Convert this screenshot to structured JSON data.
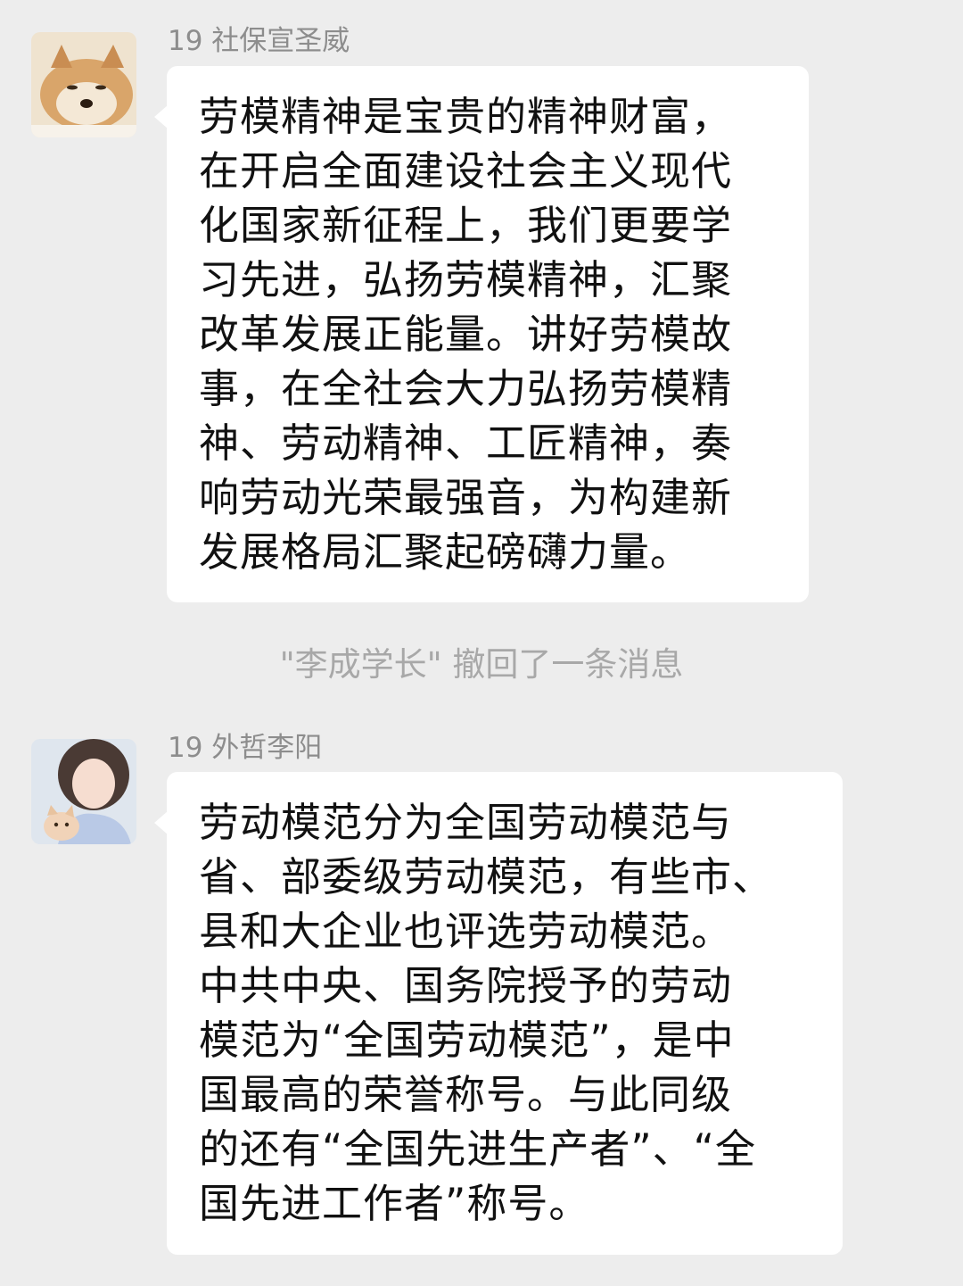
{
  "messages": [
    {
      "sender": "19 社保宣圣威",
      "avatar": "shiba-dog-avatar",
      "lines": [
        "劳模精神是宝贵的精神财富，",
        "在开启全面建设社会主义现代",
        "化国家新征程上，我们更要学",
        "习先进，弘扬劳模精神，汇聚",
        "改革发展正能量。讲好劳模故",
        "事，在全社会大力弘扬劳模精",
        "神、劳动精神、工匠精神，奏",
        "响劳动光荣最强音，为构建新",
        "发展格局汇聚起磅礴力量。"
      ]
    },
    {
      "sender": "19 外哲李阳",
      "avatar": "girl-with-cat-avatar",
      "lines": [
        "劳动模范分为全国劳动模范与",
        "省、部委级劳动模范，有些市、",
        "县和大企业也评选劳动模范。",
        "中共中央、国务院授予的劳动",
        "模范为“全国劳动模范”，是中",
        "国最高的荣誉称号。与此同级",
        "的还有“全国先进生产者”、“全",
        "国先进工作者”称号。"
      ]
    }
  ],
  "system_notice": "\"李成学长\" 撤回了一条消息",
  "colors": {
    "background": "#ededed",
    "bubble": "#ffffff",
    "sender_name": "#8d8d8d",
    "system_text": "#a8a8a8"
  }
}
